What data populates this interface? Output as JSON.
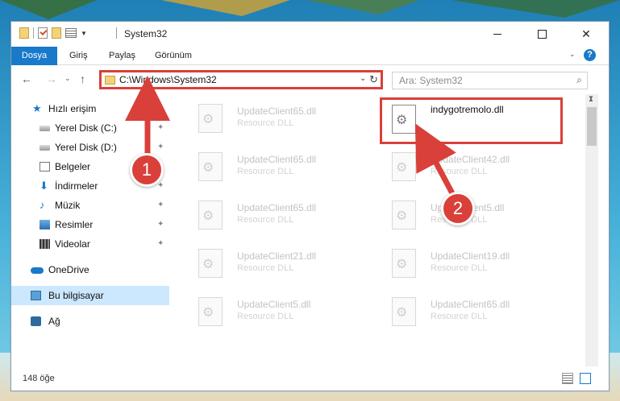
{
  "colors": {
    "accent": "#1979ca",
    "annotation_red": "#d9403a",
    "selection": "#cce8ff"
  },
  "titlebar": {
    "title": "System32",
    "icons": [
      "folder-icon",
      "checkmark-icon",
      "folder-icon",
      "properties-icon",
      "chevron-down-icon"
    ],
    "minimize_icon": "minimize-icon",
    "maximize_icon": "maximize-icon",
    "close_label": "✕"
  },
  "ribbon": {
    "tabs": [
      {
        "label": "Dosya"
      },
      {
        "label": "Giriş"
      },
      {
        "label": "Paylaş"
      },
      {
        "label": "Görünüm"
      }
    ],
    "help_label": "?"
  },
  "nav": {
    "back": "←",
    "forward": "→",
    "up": "↑",
    "address": "C:\\Windows\\System32",
    "refresh": "↻",
    "search_placeholder": "Ara: System32"
  },
  "sidebar": {
    "items": [
      {
        "label": "Hızlı erişim",
        "icon": "star-icon"
      },
      {
        "label": "Yerel Disk (C:)",
        "icon": "drive-icon",
        "pinned": true
      },
      {
        "label": "Yerel Disk (D:)",
        "icon": "drive-icon",
        "pinned": true
      },
      {
        "label": "Belgeler",
        "icon": "document-icon",
        "pinned": true
      },
      {
        "label": "İndirmeler",
        "icon": "download-icon",
        "pinned": true
      },
      {
        "label": "Müzik",
        "icon": "music-icon",
        "pinned": true
      },
      {
        "label": "Resimler",
        "icon": "pictures-icon",
        "pinned": true
      },
      {
        "label": "Videolar",
        "icon": "video-icon",
        "pinned": true
      },
      {
        "label": "OneDrive",
        "icon": "cloud-icon"
      },
      {
        "label": "Bu bilgisayar",
        "icon": "computer-icon",
        "selected": true
      },
      {
        "label": "Ağ",
        "icon": "network-icon"
      }
    ],
    "pin_glyph": "📌"
  },
  "files": [
    {
      "name": "UpdateClient65.dll",
      "type": "Resource DLL"
    },
    {
      "name": "indygotremolo.dll",
      "type": "",
      "highlighted": true
    },
    {
      "name": "UpdateClient65.dll",
      "type": "Resource DLL"
    },
    {
      "name": "UpdateClient42.dll",
      "type": "Resource DLL"
    },
    {
      "name": "UpdateClient65.dll",
      "type": "Resource DLL"
    },
    {
      "name": "UpdateClient5.dll",
      "type": "Resource DLL"
    },
    {
      "name": "UpdateClient21.dll",
      "type": "Resource DLL"
    },
    {
      "name": "UpdateClient19.dll",
      "type": "Resource DLL"
    },
    {
      "name": "UpdateClient5.dll",
      "type": "Resource DLL"
    },
    {
      "name": "UpdateClient65.dll",
      "type": "Resource DLL"
    }
  ],
  "status": {
    "item_count": "148 öğe"
  },
  "annotations": {
    "step1": "1",
    "step2": "2"
  }
}
